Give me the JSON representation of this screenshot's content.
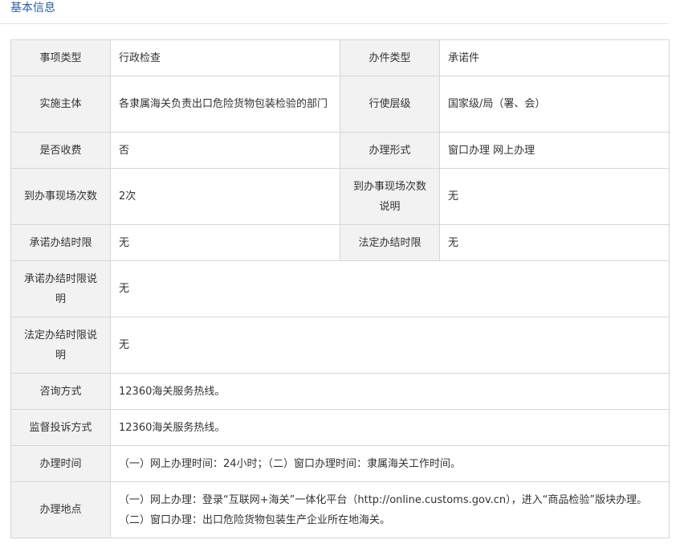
{
  "section": {
    "title": "基本信息"
  },
  "rows": [
    {
      "l1": "事项类型",
      "v1": "行政检查",
      "l2": "办件类型",
      "v2": "承诺件"
    },
    {
      "l1": "实施主体",
      "v1": "各隶属海关负责出口危险货物包装检验的部门",
      "l2": "行使层级",
      "v2": "国家级/局（署、会）"
    },
    {
      "l1": "是否收费",
      "v1": "否",
      "l2": "办理形式",
      "v2": "窗口办理 网上办理"
    },
    {
      "l1": "到办事现场次数",
      "v1": "2次",
      "l2": "到办事现场次数说明",
      "v2": "无"
    },
    {
      "l1": "承诺办结时限",
      "v1": "无",
      "l2": "法定办结时限",
      "v2": "无"
    }
  ],
  "wide_rows": [
    {
      "label": "承诺办结时限说明",
      "value": "无"
    },
    {
      "label": "法定办结时限说明",
      "value": "无"
    },
    {
      "label": "咨询方式",
      "value": "12360海关服务热线。"
    },
    {
      "label": "监督投诉方式",
      "value": "12360海关服务热线。"
    },
    {
      "label": "办理时间",
      "value": "（一）网上办理时间：24小时；（二）窗口办理时间：隶属海关工作时间。"
    },
    {
      "label": "办理地点",
      "value": "（一）网上办理：登录“互联网+海关”一体化平台（http://online.customs.gov.cn），进入“商品检验”版块办理。（二）窗口办理：出口危险货物包装生产企业所在地海关。"
    }
  ]
}
